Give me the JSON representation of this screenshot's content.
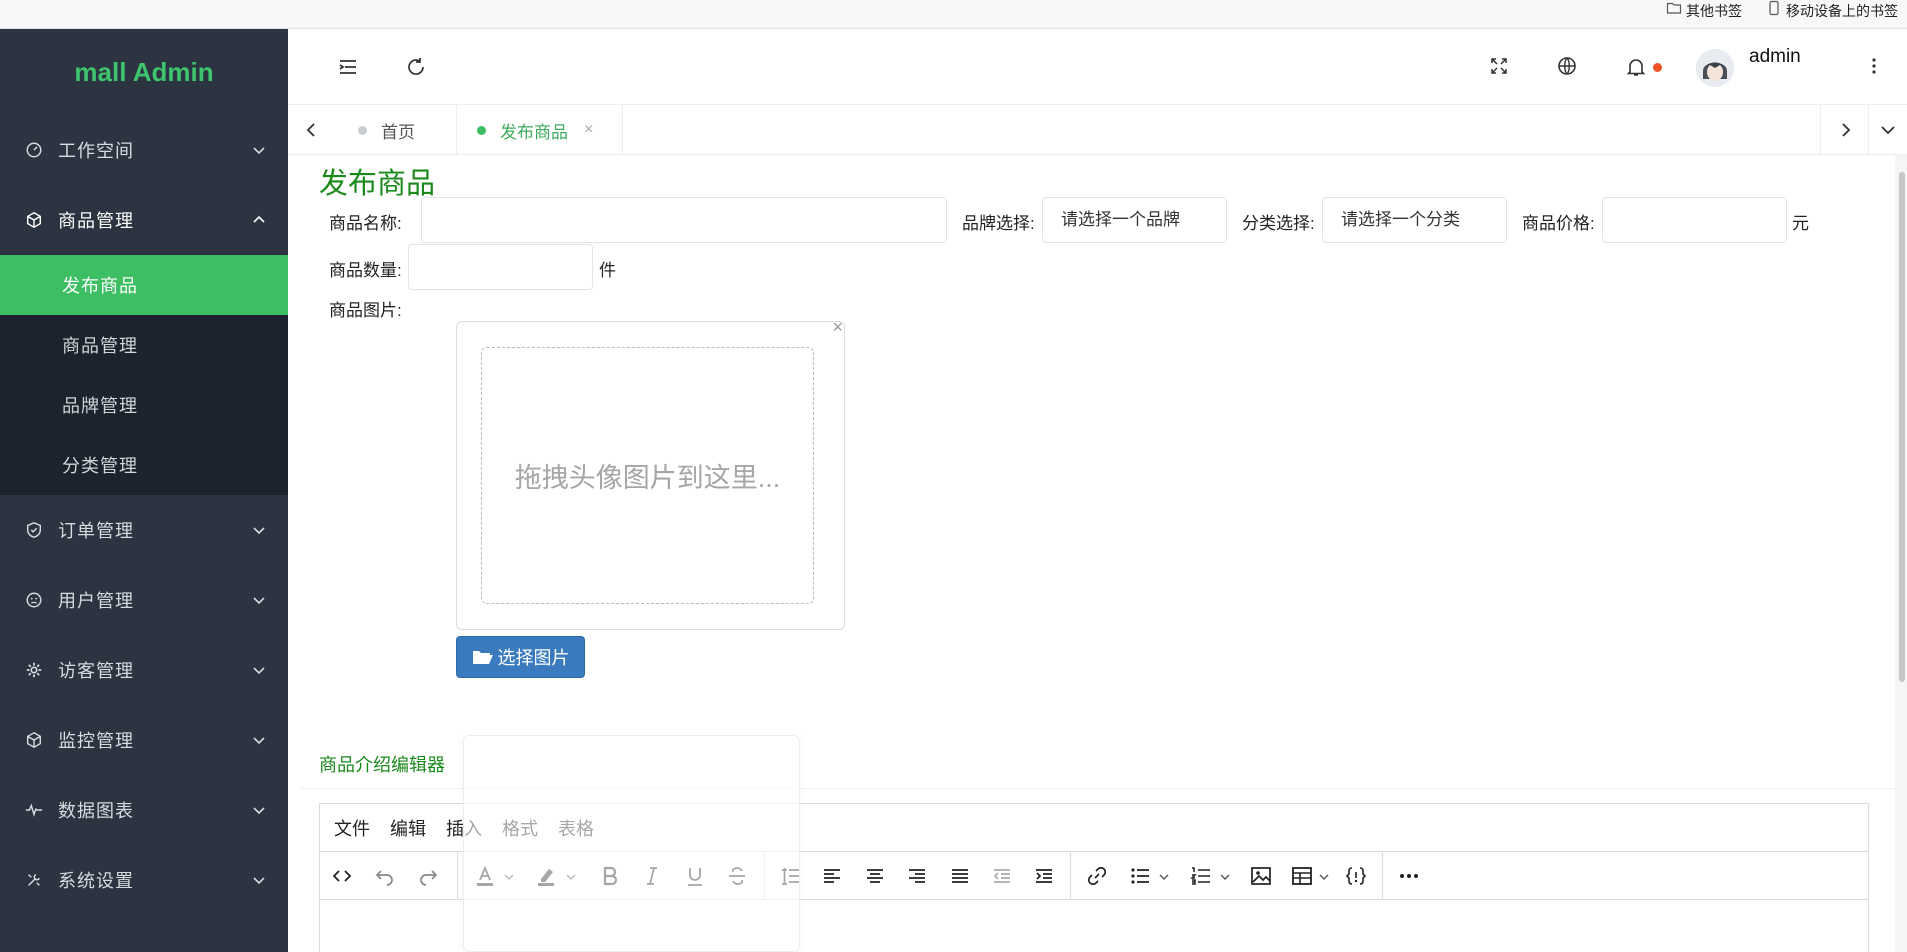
{
  "bookmarks": [
    {
      "label": "其他书签",
      "icon": "folder-icon"
    },
    {
      "label": "移动设备上的书签",
      "icon": "phone-icon"
    }
  ],
  "sidebar": {
    "logo": "mall Admin",
    "items": [
      {
        "label": "工作空间",
        "icon": "dashboard-icon",
        "open": false
      },
      {
        "label": "商品管理",
        "icon": "box-icon",
        "open": true,
        "children": [
          {
            "label": "发布商品",
            "active": true
          },
          {
            "label": "商品管理",
            "active": false
          },
          {
            "label": "品牌管理",
            "active": false
          },
          {
            "label": "分类管理",
            "active": false
          }
        ]
      },
      {
        "label": "订单管理",
        "icon": "shield-check-icon",
        "open": false
      },
      {
        "label": "用户管理",
        "icon": "face-icon",
        "open": false
      },
      {
        "label": "访客管理",
        "icon": "gear-icon",
        "open": false
      },
      {
        "label": "监控管理",
        "icon": "cube-icon",
        "open": false
      },
      {
        "label": "数据图表",
        "icon": "pulse-icon",
        "open": false
      },
      {
        "label": "系统设置",
        "icon": "tools-icon",
        "open": false
      }
    ]
  },
  "header": {
    "username": "admin",
    "icons": [
      "menu-fold-icon",
      "refresh-icon",
      "fullscreen-icon",
      "globe-icon",
      "bell-icon",
      "more-vertical-icon"
    ]
  },
  "tabs": [
    {
      "label": "首页",
      "active": false
    },
    {
      "label": "发布商品",
      "active": true,
      "closable": true
    }
  ],
  "form": {
    "title": "发布商品",
    "name_label": "商品名称:",
    "name_value": "",
    "brand_label": "品牌选择:",
    "brand_value": "请选择一个品牌",
    "category_label": "分类选择:",
    "category_value": "请选择一个分类",
    "price_label": "商品价格:",
    "price_value": "",
    "price_unit": "元",
    "quantity_label": "商品数量:",
    "quantity_value": "",
    "quantity_unit": "件",
    "image_label": "商品图片:",
    "drop_text": "拖拽头像图片到这里...",
    "choose_button": "选择图片",
    "close_glyph": "×"
  },
  "editor": {
    "title": "商品介绍编辑器",
    "menus": [
      "文件",
      "编辑",
      "插入",
      "格式",
      "表格"
    ],
    "toolbar": [
      "code-view-icon",
      "undo-icon",
      "redo-icon",
      "font-color-icon",
      "highlight-icon",
      "bold-icon",
      "italic-icon",
      "underline-icon",
      "strikethrough-icon",
      "line-height-icon",
      "align-left-icon",
      "align-center-icon",
      "align-right-icon",
      "align-justify-icon",
      "outdent-icon",
      "indent-icon",
      "link-icon",
      "bullet-list-icon",
      "numbered-list-icon",
      "image-icon",
      "table-icon",
      "code-sample-icon",
      "more-icon"
    ]
  },
  "colors": {
    "sidebar_bg": "#2b3440",
    "submenu_bg": "#1c232c",
    "accent_green": "#3ebe63",
    "title_green": "#1a8a1a",
    "button_blue": "#3a7bbf",
    "notify_red": "#ef5326"
  }
}
